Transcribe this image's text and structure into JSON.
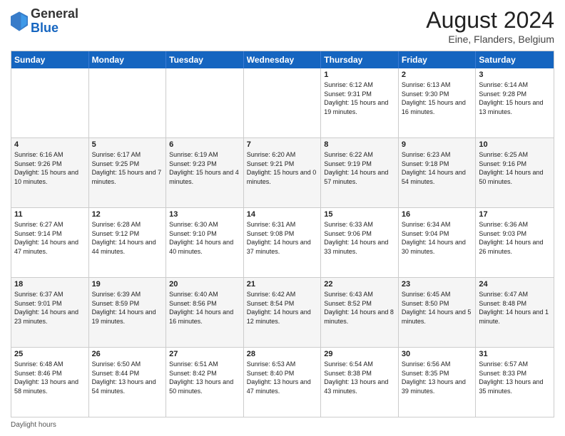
{
  "header": {
    "logo_general": "General",
    "logo_blue": "Blue",
    "month_title": "August 2024",
    "location": "Eine, Flanders, Belgium"
  },
  "weekdays": [
    "Sunday",
    "Monday",
    "Tuesday",
    "Wednesday",
    "Thursday",
    "Friday",
    "Saturday"
  ],
  "footer": {
    "daylight_label": "Daylight hours"
  },
  "weeks": [
    [
      {
        "day": "",
        "info": ""
      },
      {
        "day": "",
        "info": ""
      },
      {
        "day": "",
        "info": ""
      },
      {
        "day": "",
        "info": ""
      },
      {
        "day": "1",
        "info": "Sunrise: 6:12 AM\nSunset: 9:31 PM\nDaylight: 15 hours and 19 minutes."
      },
      {
        "day": "2",
        "info": "Sunrise: 6:13 AM\nSunset: 9:30 PM\nDaylight: 15 hours and 16 minutes."
      },
      {
        "day": "3",
        "info": "Sunrise: 6:14 AM\nSunset: 9:28 PM\nDaylight: 15 hours and 13 minutes."
      }
    ],
    [
      {
        "day": "4",
        "info": "Sunrise: 6:16 AM\nSunset: 9:26 PM\nDaylight: 15 hours and 10 minutes."
      },
      {
        "day": "5",
        "info": "Sunrise: 6:17 AM\nSunset: 9:25 PM\nDaylight: 15 hours and 7 minutes."
      },
      {
        "day": "6",
        "info": "Sunrise: 6:19 AM\nSunset: 9:23 PM\nDaylight: 15 hours and 4 minutes."
      },
      {
        "day": "7",
        "info": "Sunrise: 6:20 AM\nSunset: 9:21 PM\nDaylight: 15 hours and 0 minutes."
      },
      {
        "day": "8",
        "info": "Sunrise: 6:22 AM\nSunset: 9:19 PM\nDaylight: 14 hours and 57 minutes."
      },
      {
        "day": "9",
        "info": "Sunrise: 6:23 AM\nSunset: 9:18 PM\nDaylight: 14 hours and 54 minutes."
      },
      {
        "day": "10",
        "info": "Sunrise: 6:25 AM\nSunset: 9:16 PM\nDaylight: 14 hours and 50 minutes."
      }
    ],
    [
      {
        "day": "11",
        "info": "Sunrise: 6:27 AM\nSunset: 9:14 PM\nDaylight: 14 hours and 47 minutes."
      },
      {
        "day": "12",
        "info": "Sunrise: 6:28 AM\nSunset: 9:12 PM\nDaylight: 14 hours and 44 minutes."
      },
      {
        "day": "13",
        "info": "Sunrise: 6:30 AM\nSunset: 9:10 PM\nDaylight: 14 hours and 40 minutes."
      },
      {
        "day": "14",
        "info": "Sunrise: 6:31 AM\nSunset: 9:08 PM\nDaylight: 14 hours and 37 minutes."
      },
      {
        "day": "15",
        "info": "Sunrise: 6:33 AM\nSunset: 9:06 PM\nDaylight: 14 hours and 33 minutes."
      },
      {
        "day": "16",
        "info": "Sunrise: 6:34 AM\nSunset: 9:04 PM\nDaylight: 14 hours and 30 minutes."
      },
      {
        "day": "17",
        "info": "Sunrise: 6:36 AM\nSunset: 9:03 PM\nDaylight: 14 hours and 26 minutes."
      }
    ],
    [
      {
        "day": "18",
        "info": "Sunrise: 6:37 AM\nSunset: 9:01 PM\nDaylight: 14 hours and 23 minutes."
      },
      {
        "day": "19",
        "info": "Sunrise: 6:39 AM\nSunset: 8:59 PM\nDaylight: 14 hours and 19 minutes."
      },
      {
        "day": "20",
        "info": "Sunrise: 6:40 AM\nSunset: 8:56 PM\nDaylight: 14 hours and 16 minutes."
      },
      {
        "day": "21",
        "info": "Sunrise: 6:42 AM\nSunset: 8:54 PM\nDaylight: 14 hours and 12 minutes."
      },
      {
        "day": "22",
        "info": "Sunrise: 6:43 AM\nSunset: 8:52 PM\nDaylight: 14 hours and 8 minutes."
      },
      {
        "day": "23",
        "info": "Sunrise: 6:45 AM\nSunset: 8:50 PM\nDaylight: 14 hours and 5 minutes."
      },
      {
        "day": "24",
        "info": "Sunrise: 6:47 AM\nSunset: 8:48 PM\nDaylight: 14 hours and 1 minute."
      }
    ],
    [
      {
        "day": "25",
        "info": "Sunrise: 6:48 AM\nSunset: 8:46 PM\nDaylight: 13 hours and 58 minutes."
      },
      {
        "day": "26",
        "info": "Sunrise: 6:50 AM\nSunset: 8:44 PM\nDaylight: 13 hours and 54 minutes."
      },
      {
        "day": "27",
        "info": "Sunrise: 6:51 AM\nSunset: 8:42 PM\nDaylight: 13 hours and 50 minutes."
      },
      {
        "day": "28",
        "info": "Sunrise: 6:53 AM\nSunset: 8:40 PM\nDaylight: 13 hours and 47 minutes."
      },
      {
        "day": "29",
        "info": "Sunrise: 6:54 AM\nSunset: 8:38 PM\nDaylight: 13 hours and 43 minutes."
      },
      {
        "day": "30",
        "info": "Sunrise: 6:56 AM\nSunset: 8:35 PM\nDaylight: 13 hours and 39 minutes."
      },
      {
        "day": "31",
        "info": "Sunrise: 6:57 AM\nSunset: 8:33 PM\nDaylight: 13 hours and 35 minutes."
      }
    ]
  ]
}
